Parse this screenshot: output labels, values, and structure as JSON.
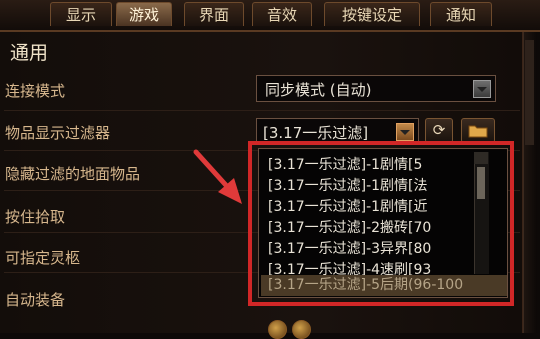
{
  "tabs": [
    {
      "label": "显示",
      "active": false
    },
    {
      "label": "游戏",
      "active": true
    },
    {
      "label": "界面",
      "active": false
    },
    {
      "label": "音效",
      "active": false
    },
    {
      "label": "按键设定",
      "active": false
    },
    {
      "label": "通知",
      "active": false
    }
  ],
  "section_title": "通用",
  "settings": {
    "connect_mode": {
      "label": "连接模式",
      "value": "同步模式 (自动)"
    },
    "item_filter": {
      "label": "物品显示过滤器",
      "value": "[3.17一乐过滤]"
    },
    "hide_filtered": {
      "label": "隐藏过滤的地面物品"
    },
    "hold_pickup": {
      "label": "按住拾取"
    },
    "assign_spirit": {
      "label": "可指定灵柩"
    },
    "auto_equip": {
      "label": "自动装备"
    }
  },
  "dropdown_options": [
    "[3.17一乐过滤]-1剧情[5",
    "[3.17一乐过滤]-1剧情[法",
    "[3.17一乐过滤]-1剧情[近",
    "[3.17一乐过滤]-2搬砖[70",
    "[3.17一乐过滤]-3异界[80",
    "[3.17一乐过滤]-4速刷[93",
    "[3.17一乐过滤]-5后期(96-100"
  ],
  "selected_option_index": 6,
  "colors": {
    "highlight": "#d12727",
    "arrow": "#e03a3a",
    "label": "#d7b78d"
  }
}
